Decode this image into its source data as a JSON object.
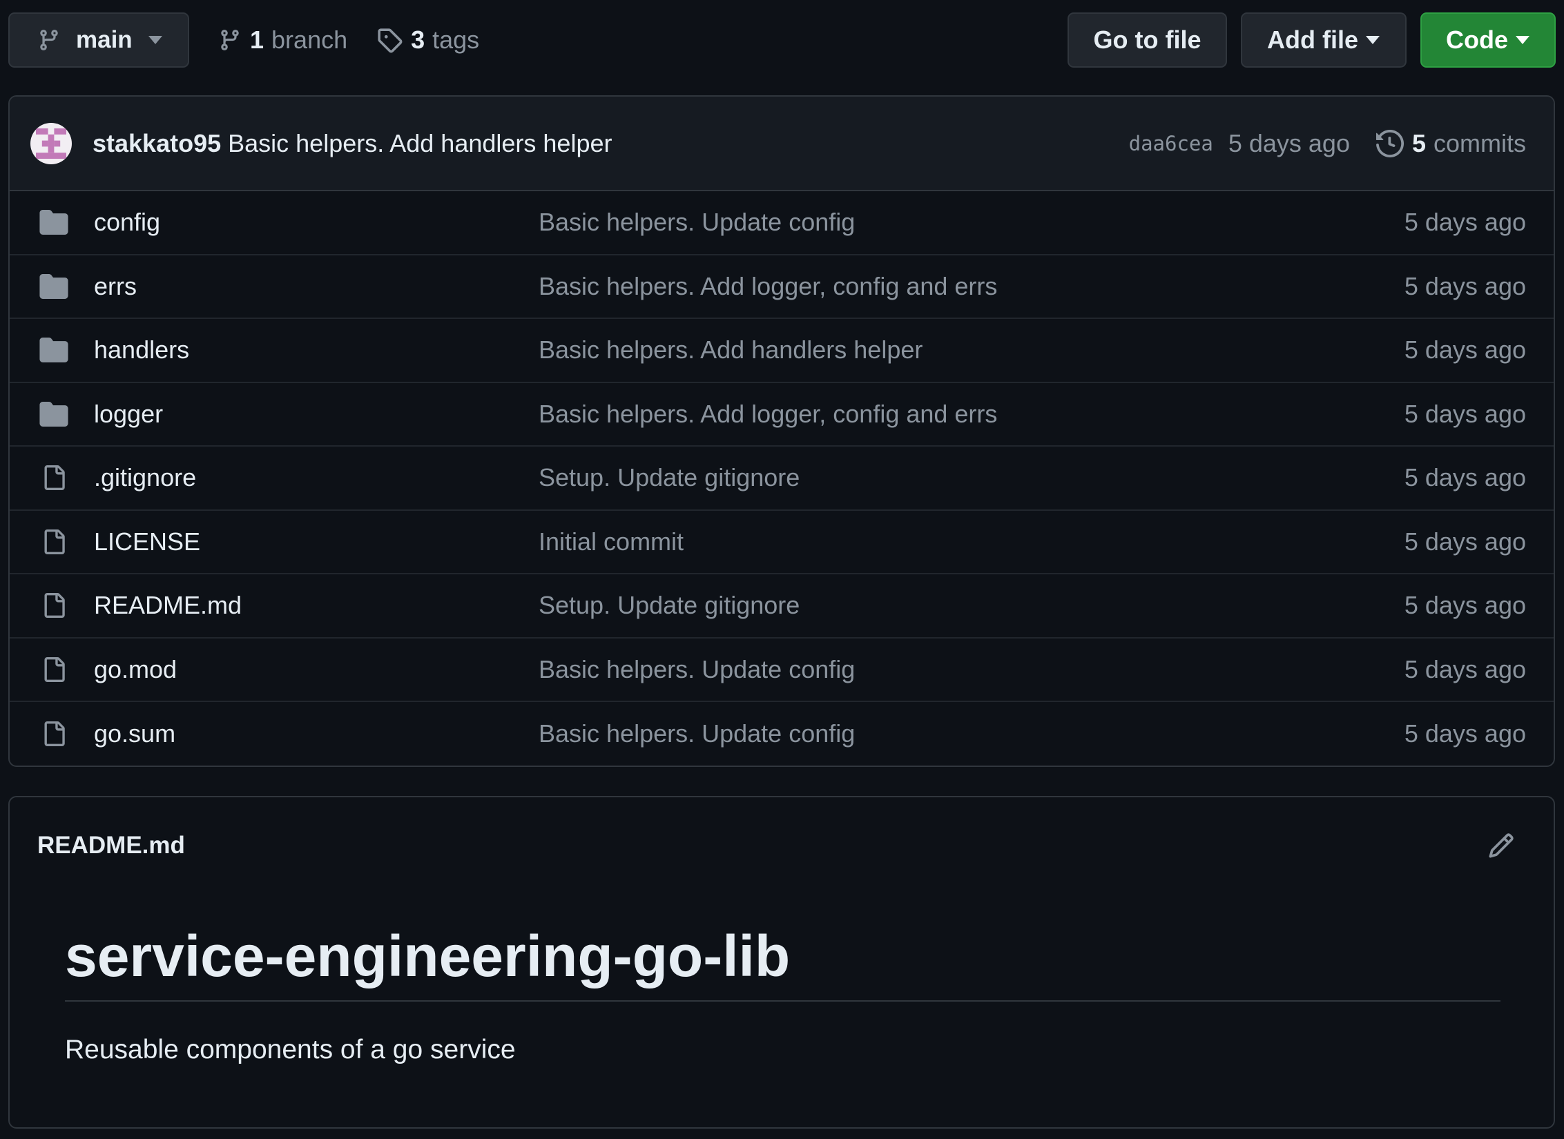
{
  "toolbar": {
    "branch_name": "main",
    "branch_count": "1",
    "branch_label": "branch",
    "tag_count": "3",
    "tag_label": "tags",
    "go_to_file_label": "Go to file",
    "add_file_label": "Add file",
    "code_label": "Code"
  },
  "latest_commit": {
    "author": "stakkato95",
    "message": "Basic helpers. Add handlers helper",
    "sha": "daa6cea",
    "age": "5 days ago",
    "commit_count": "5",
    "commit_label": "commits"
  },
  "files": [
    {
      "type": "folder",
      "name": "config",
      "message": "Basic helpers. Update config",
      "age": "5 days ago"
    },
    {
      "type": "folder",
      "name": "errs",
      "message": "Basic helpers. Add logger, config and errs",
      "age": "5 days ago"
    },
    {
      "type": "folder",
      "name": "handlers",
      "message": "Basic helpers. Add handlers helper",
      "age": "5 days ago"
    },
    {
      "type": "folder",
      "name": "logger",
      "message": "Basic helpers. Add logger, config and errs",
      "age": "5 days ago"
    },
    {
      "type": "file",
      "name": ".gitignore",
      "message": "Setup. Update gitignore",
      "age": "5 days ago"
    },
    {
      "type": "file",
      "name": "LICENSE",
      "message": "Initial commit",
      "age": "5 days ago"
    },
    {
      "type": "file",
      "name": "README.md",
      "message": "Setup. Update gitignore",
      "age": "5 days ago"
    },
    {
      "type": "file",
      "name": "go.mod",
      "message": "Basic helpers. Update config",
      "age": "5 days ago"
    },
    {
      "type": "file",
      "name": "go.sum",
      "message": "Basic helpers. Update config",
      "age": "5 days ago"
    }
  ],
  "readme": {
    "filename": "README.md",
    "heading": "service-engineering-go-lib",
    "description": "Reusable components of a go service"
  },
  "colors": {
    "background": "#0d1117",
    "border": "#30363d",
    "code_button": "#238636",
    "muted_text": "#8b949e"
  }
}
